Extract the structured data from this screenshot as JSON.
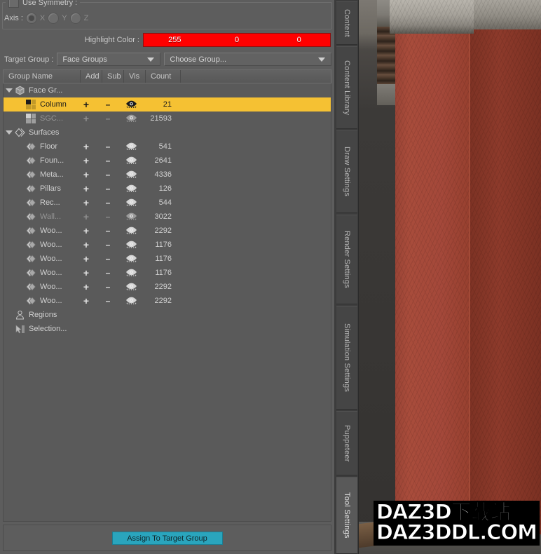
{
  "symmetry": {
    "use_symmetry_label": "Use Symmetry :",
    "use_symmetry_checked": false,
    "axis_label": "Axis :",
    "axis_options": [
      "X",
      "Y",
      "Z"
    ],
    "axis_selected": "X"
  },
  "highlight": {
    "label": "Highlight Color :",
    "r": "255",
    "g": "0",
    "b": "0",
    "color": "#ff0000"
  },
  "target": {
    "label": "Target Group :",
    "group_value": "Face Groups",
    "choose_value": "Choose Group..."
  },
  "list_header": {
    "columns": [
      "Group Name",
      "Add",
      "Sub",
      "Vis",
      "Count"
    ]
  },
  "tree": {
    "nodes": [
      {
        "label": "Face Gr...",
        "icon": "cube-icon",
        "type": "group",
        "expanded": true,
        "depth": 0
      },
      {
        "label": "Column",
        "icon": "face-group-icon",
        "type": "item",
        "depth": 1,
        "selected": true,
        "add": "+",
        "sub": "–",
        "vis": "eye-icon",
        "count": "21"
      },
      {
        "label": "SGC...",
        "icon": "face-group-icon",
        "type": "item",
        "depth": 1,
        "dim": true,
        "add": "+",
        "sub": "–",
        "vis": "eye-icon",
        "count": "21593"
      },
      {
        "label": "Surfaces",
        "icon": "surfaces-icon",
        "type": "group",
        "expanded": true,
        "depth": 0
      },
      {
        "label": "Floor",
        "icon": "surface-icon",
        "type": "item",
        "depth": 1,
        "add": "+",
        "sub": "–",
        "vis": "eye-icon",
        "count": "541"
      },
      {
        "label": "Foun...",
        "icon": "surface-icon",
        "type": "item",
        "depth": 1,
        "add": "+",
        "sub": "–",
        "vis": "eye-icon",
        "count": "2641"
      },
      {
        "label": "Meta...",
        "icon": "surface-icon",
        "type": "item",
        "depth": 1,
        "add": "+",
        "sub": "–",
        "vis": "eye-icon",
        "count": "4336"
      },
      {
        "label": "Pillars",
        "icon": "surface-icon",
        "type": "item",
        "depth": 1,
        "add": "+",
        "sub": "–",
        "vis": "eye-icon",
        "count": "126"
      },
      {
        "label": "Rec...",
        "icon": "surface-icon",
        "type": "item",
        "depth": 1,
        "add": "+",
        "sub": "–",
        "vis": "eye-icon",
        "count": "544"
      },
      {
        "label": "Wall...",
        "icon": "surface-icon",
        "type": "item",
        "depth": 1,
        "dim": true,
        "add": "+",
        "sub": "–",
        "vis": "eye-icon",
        "count": "3022"
      },
      {
        "label": "Woo...",
        "icon": "surface-icon",
        "type": "item",
        "depth": 1,
        "add": "+",
        "sub": "–",
        "vis": "eye-icon",
        "count": "2292"
      },
      {
        "label": "Woo...",
        "icon": "surface-icon",
        "type": "item",
        "depth": 1,
        "add": "+",
        "sub": "–",
        "vis": "eye-icon",
        "count": "1176"
      },
      {
        "label": "Woo...",
        "icon": "surface-icon",
        "type": "item",
        "depth": 1,
        "add": "+",
        "sub": "–",
        "vis": "eye-icon",
        "count": "1176"
      },
      {
        "label": "Woo...",
        "icon": "surface-icon",
        "type": "item",
        "depth": 1,
        "add": "+",
        "sub": "–",
        "vis": "eye-icon",
        "count": "1176"
      },
      {
        "label": "Woo...",
        "icon": "surface-icon",
        "type": "item",
        "depth": 1,
        "add": "+",
        "sub": "–",
        "vis": "eye-icon",
        "count": "2292"
      },
      {
        "label": "Woo...",
        "icon": "surface-icon",
        "type": "item",
        "depth": 1,
        "add": "+",
        "sub": "–",
        "vis": "eye-icon",
        "count": "2292"
      },
      {
        "label": "Regions",
        "icon": "regions-icon",
        "type": "leaf",
        "depth": 0
      },
      {
        "label": "Selection...",
        "icon": "selection-icon",
        "type": "leaf",
        "depth": 0
      }
    ]
  },
  "assign": {
    "label": "Assign To Target Group",
    "color": "#2aa5bd"
  },
  "tabs": {
    "items": [
      {
        "label": "Content",
        "active": false
      },
      {
        "label": "Content Library",
        "active": false
      },
      {
        "label": "Draw Settings",
        "active": false
      },
      {
        "label": "Render Settings",
        "active": false
      },
      {
        "label": "Simulation Settings",
        "active": false
      },
      {
        "label": "Puppeteer",
        "active": false
      },
      {
        "label": "Tool Settings",
        "active": true
      }
    ],
    "scroll_up": "▲",
    "scroll_down": "▼"
  },
  "viewport": {
    "watermark_line1": "DAZ3D下载站",
    "watermark_line2": "DAZ3DDL.COM"
  }
}
